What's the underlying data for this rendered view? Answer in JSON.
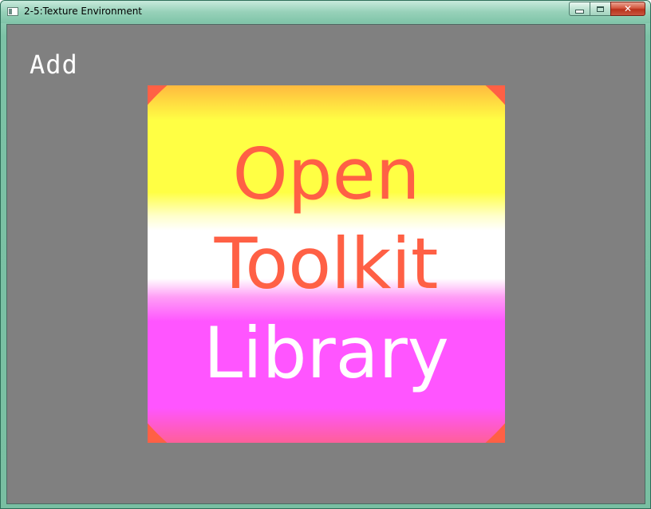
{
  "window": {
    "title": "2-5:Texture Environment",
    "app_icon": "window-icon",
    "controls": {
      "minimize_icon": "minimize-icon",
      "maximize_icon": "maximize-icon",
      "close_glyph": "✕"
    }
  },
  "viewport": {
    "background_color": "#808080",
    "mode_label": "Add",
    "texture": {
      "base_color": "#ff6045",
      "band_colors": [
        "#ffff44",
        "#ffffff",
        "#ff55ff"
      ],
      "lines": [
        {
          "text": "Open",
          "color": "#ff6045"
        },
        {
          "text": "Toolkit",
          "color": "#ff6045"
        },
        {
          "text": "Library",
          "color": "#ffffff"
        }
      ]
    }
  }
}
